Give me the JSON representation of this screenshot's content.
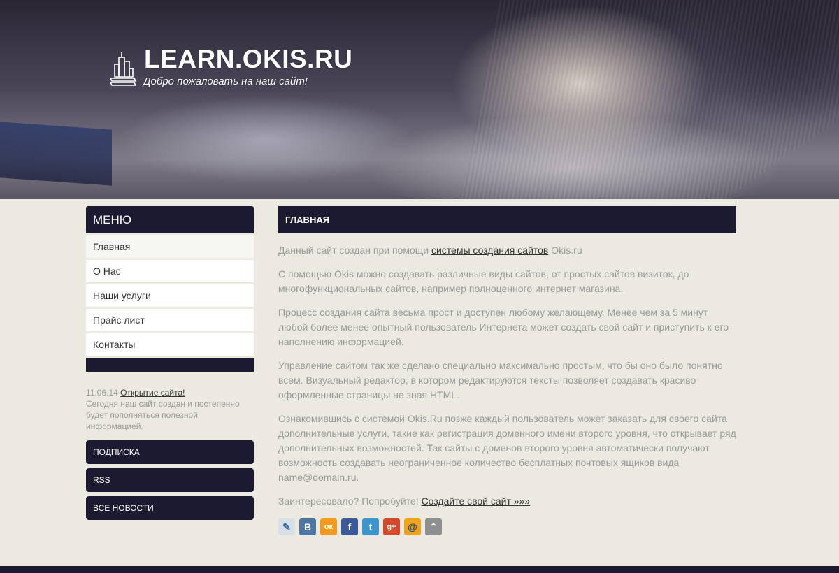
{
  "header": {
    "site_title": "LEARN.OKIS.RU",
    "slogan": "Добро пожаловать на наш сайт!"
  },
  "menu": {
    "title": "МЕНЮ",
    "items": [
      {
        "label": "Главная",
        "active": true
      },
      {
        "label": "О Нас",
        "active": false
      },
      {
        "label": "Наши услуги",
        "active": false
      },
      {
        "label": "Прайс лист",
        "active": false
      },
      {
        "label": "Контакты",
        "active": false
      }
    ]
  },
  "news": {
    "date": "11.06.14",
    "link": "Открытие сайта!",
    "text": "Сегодня наш сайт создан и постепенно будет пополняться полезной информацией."
  },
  "side_buttons": [
    "ПОДПИСКА",
    "RSS",
    "ВСЕ НОВОСТИ"
  ],
  "content": {
    "title": "ГЛАВНАЯ",
    "p1_before": "Данный сайт создан при помощи ",
    "p1_link": "системы создания сайтов",
    "p1_after": " Okis.ru",
    "p2": "С помощью Okis можно создавать различные виды сайтов, от простых сайтов визиток, до многофункциональных сайтов, например полноценного интернет магазина.",
    "p3": "Процесс создания сайта весьма прост и доступен любому желающему. Менее чем за 5 минут любой более менее опытный пользователь Интернета может создать свой сайт и приступить к его наполнению информацией.",
    "p4": "Управление сайтом так же сделано специально максимально простым, что бы оно было понятно всем. Визуальный редактор, в котором редактируются тексты позволяет создавать красиво оформленные страницы не зная HTML.",
    "p5": "Ознакомившись с системой Okis.Ru позже каждый пользователь может заказать для своего сайта дополнительные услуги, такие как регистрация доменного имени второго уровня, что открывает ряд дополнительных возможностей. Так сайты с доменов второго уровня автоматически получают возможность создавать неограниченное количество бесплатных почтовых ящиков вида name@domain.ru.",
    "p6_before": "Заинтересовало? Попробуйте! ",
    "p6_link": "Создайте свой сайт »»»"
  },
  "share_icons": [
    {
      "name": "livejournal-icon",
      "glyph": "✎",
      "color": "#d7dfe8",
      "fg": "#3a6a9a"
    },
    {
      "name": "vkontakte-icon",
      "glyph": "В",
      "color": "#4c75a3",
      "fg": "#ffffff"
    },
    {
      "name": "odnoklassniki-icon",
      "glyph": "ок",
      "color": "#f59a1c",
      "fg": "#ffffff"
    },
    {
      "name": "facebook-icon",
      "glyph": "f",
      "color": "#3b5998",
      "fg": "#ffffff"
    },
    {
      "name": "twitter-icon",
      "glyph": "t",
      "color": "#3d95d0",
      "fg": "#ffffff"
    },
    {
      "name": "google-plus-icon",
      "glyph": "g+",
      "color": "#d3492c",
      "fg": "#ffffff"
    },
    {
      "name": "mail-ru-icon",
      "glyph": "@",
      "color": "#f2a31b",
      "fg": "#1c4f8c"
    },
    {
      "name": "more-icon",
      "glyph": "⌃",
      "color": "#8f8f8f",
      "fg": "#ffffff"
    }
  ],
  "colors": {
    "dark_panel": "#1c1a30",
    "page_bg": "#eceae0",
    "body_text": "#999999",
    "link_text": "#333333"
  }
}
